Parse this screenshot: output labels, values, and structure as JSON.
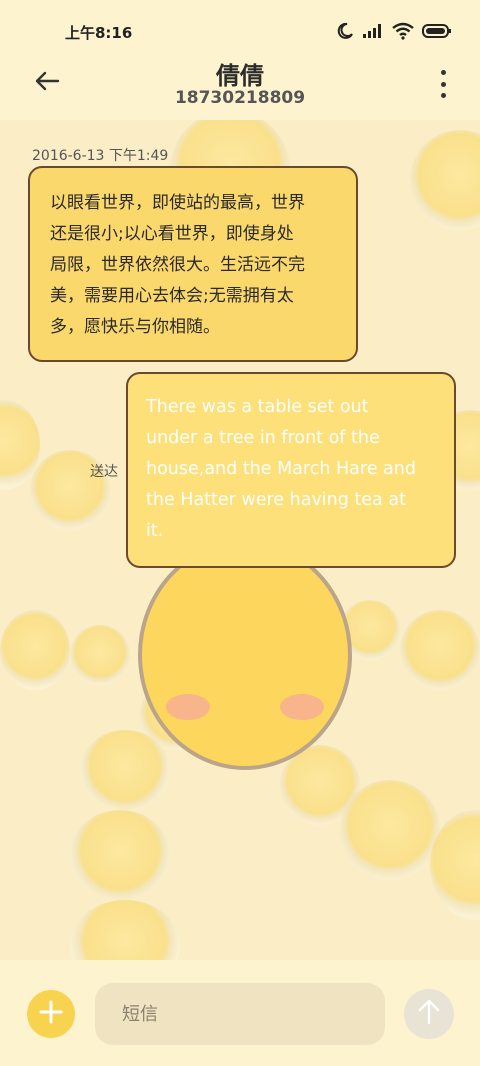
{
  "status_bar": {
    "time": "上午8:16",
    "icons": [
      "moon-icon",
      "signal-icon",
      "wifi-icon",
      "battery-icon"
    ]
  },
  "header": {
    "contact_name": "倩倩",
    "contact_number": "18730218809",
    "back_icon": "back-arrow-icon",
    "menu_icon": "more-vertical-icon"
  },
  "conversation": {
    "timestamp": "2016-6-13 下午1:49",
    "incoming": {
      "lines": [
        "以眼看世界，即使站的最高，世界",
        "还是很小;以心看世界，即使身处",
        "局限，世界依然很大。生活远不完",
        "美，需要用心去体会;无需拥有太",
        "多，愿快乐与你相随。"
      ]
    },
    "outgoing": {
      "lines": [
        "There was a table set out",
        "under a tree in front of the",
        "house,and the March Hare and",
        "the Hatter were having tea at",
        "it."
      ],
      "status": "送达"
    }
  },
  "composer": {
    "placeholder": "短信",
    "value": "",
    "add_icon": "plus-icon",
    "send_icon": "send-arrow-up-icon"
  },
  "colors": {
    "background": "#fdf3cf",
    "bubble_in": "#fbd86b",
    "bubble_out": "#fde07a",
    "bubble_border": "#6b4a2c",
    "add_button": "#f8d34f"
  }
}
